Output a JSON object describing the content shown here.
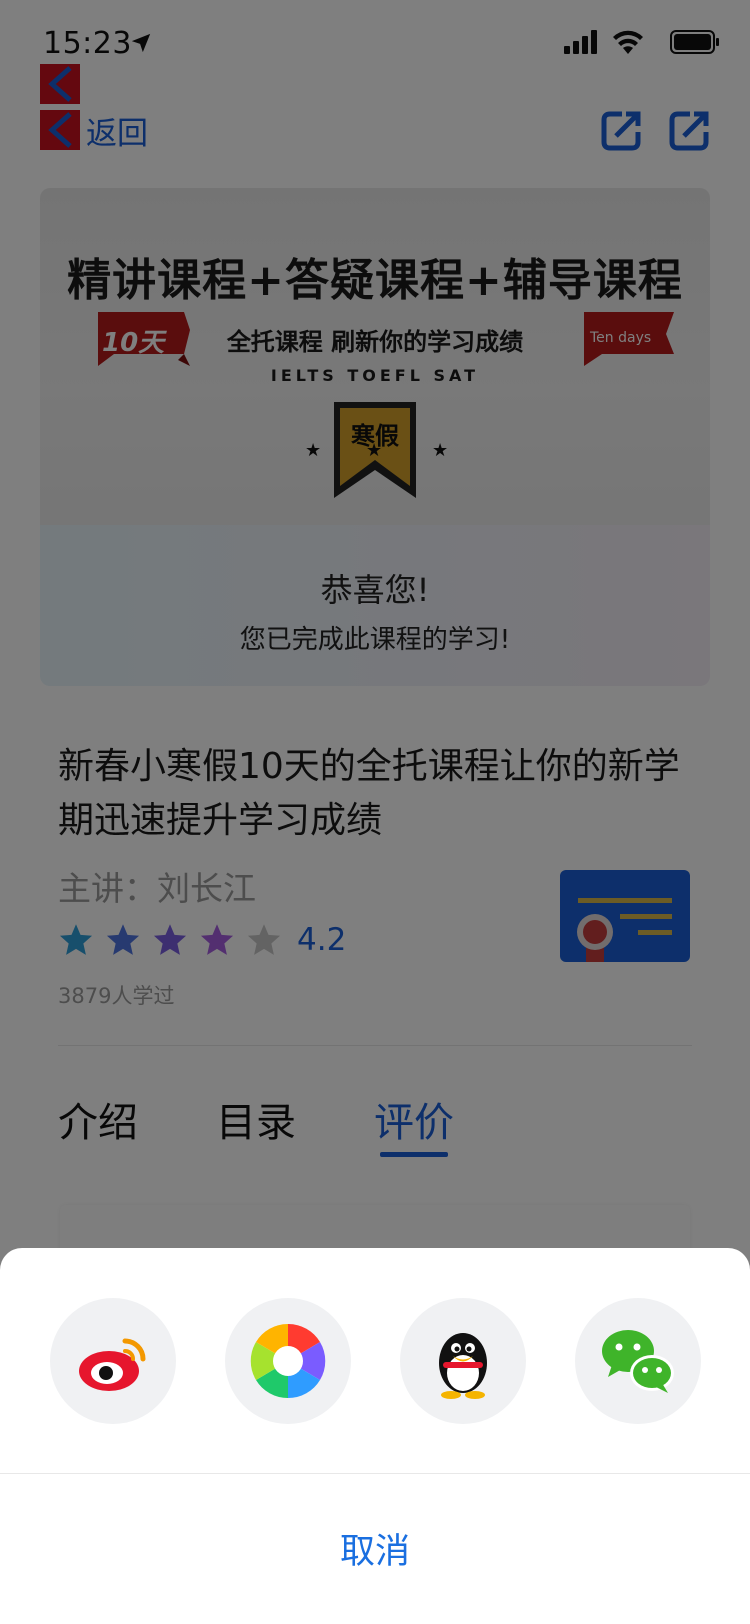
{
  "status_bar": {
    "time": "15:23"
  },
  "nav": {
    "back_label": "返回"
  },
  "banner": {
    "headline": "精讲课程+答疑课程+辅导课程",
    "subheadline": "全托课程 刷新你的学习成绩",
    "exams": "IELTS  TOEFL  SAT",
    "ribbon_left": "10天",
    "ribbon_right": "Ten days",
    "badge": "寒假",
    "congrats_title": "恭喜您!",
    "congrats_text": "您已完成此课程的学习!"
  },
  "course": {
    "title": "新春小寒假10天的全托课程让你的新学期迅速提升学习成绩",
    "teacher": "主讲：刘长江",
    "rating": 4.2,
    "rating_text": "4.2",
    "learners": "3879人学过"
  },
  "tabs": [
    {
      "label": "介绍",
      "active": false
    },
    {
      "label": "目录",
      "active": false
    },
    {
      "label": "评价",
      "active": true
    }
  ],
  "share_sheet": {
    "targets": [
      {
        "name": "weibo",
        "icon": "weibo-icon"
      },
      {
        "name": "moments",
        "icon": "moments-icon"
      },
      {
        "name": "qq",
        "icon": "qq-icon"
      },
      {
        "name": "wechat",
        "icon": "wechat-icon"
      }
    ],
    "cancel_label": "取消"
  },
  "colors": {
    "accent": "#1a5fd6",
    "back_square": "#c8101e",
    "cancel": "#1a6fe0"
  }
}
